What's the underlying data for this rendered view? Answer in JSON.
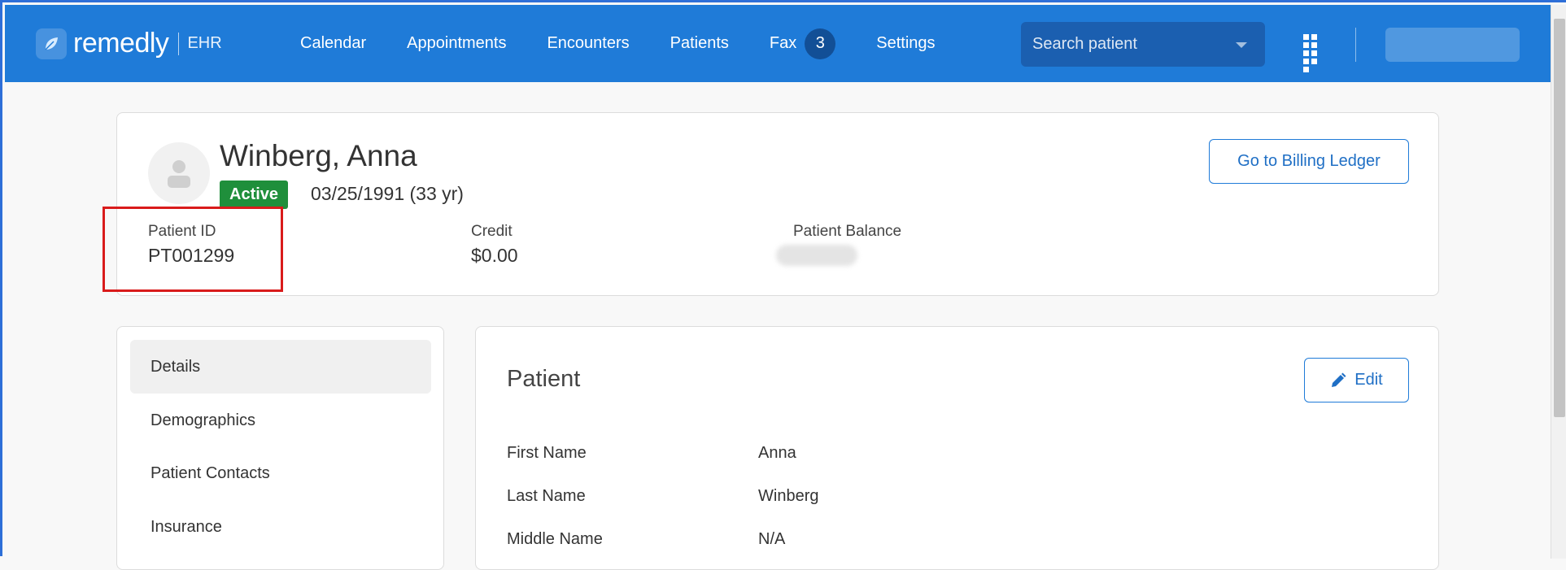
{
  "topnav": {
    "logo_text": "remedly",
    "logo_sub": "EHR",
    "items": [
      {
        "label": "Calendar"
      },
      {
        "label": "Appointments"
      },
      {
        "label": "Encounters"
      },
      {
        "label": "Patients"
      },
      {
        "label": "Fax",
        "badge": "3"
      },
      {
        "label": "Settings"
      }
    ],
    "search_placeholder": "Search patient"
  },
  "patient": {
    "name": "Winberg, Anna",
    "status": "Active",
    "dob": "03/25/1991 (33 yr)",
    "billing_button": "Go to Billing Ledger",
    "stats": {
      "patient_id_label": "Patient ID",
      "patient_id": "PT001299",
      "credit_label": "Credit",
      "credit": "$0.00",
      "balance_label": "Patient Balance"
    }
  },
  "sidenav": {
    "items": [
      {
        "label": "Details",
        "active": true
      },
      {
        "label": "Demographics"
      },
      {
        "label": "Patient Contacts"
      },
      {
        "label": "Insurance"
      }
    ]
  },
  "main": {
    "section_title": "Patient",
    "edit_label": "Edit",
    "fields": [
      {
        "label": "First Name",
        "value": "Anna"
      },
      {
        "label": "Last Name",
        "value": "Winberg"
      },
      {
        "label": "Middle Name",
        "value": "N/A"
      }
    ]
  },
  "colors": {
    "nav_bg": "#1f7bd8",
    "accent": "#1f6fc5",
    "active_status": "#1f8f3b",
    "highlight_box": "#d91b1b"
  }
}
